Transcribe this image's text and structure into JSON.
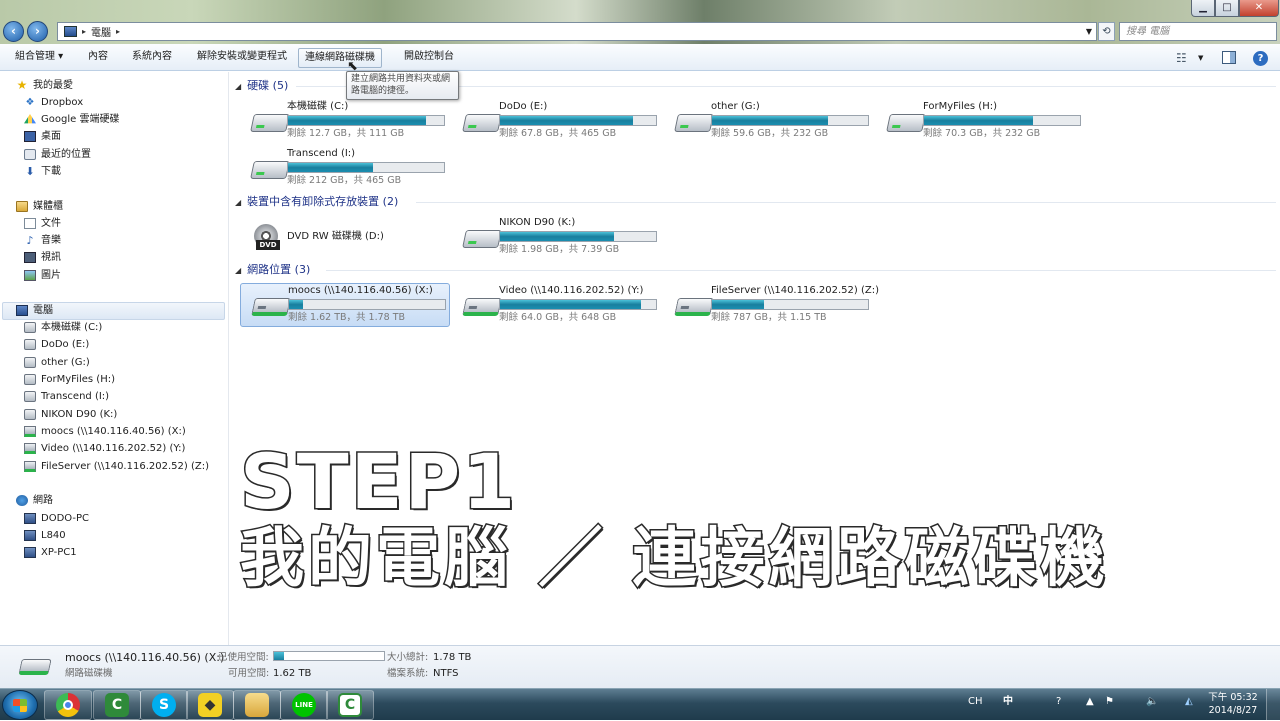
{
  "address": {
    "location": "電腦",
    "search_placeholder": "搜尋 電腦"
  },
  "window_buttons": {
    "minimize": "▁",
    "maximize": "□",
    "close": "✕"
  },
  "toolbar": {
    "organize": "組合管理 ▾",
    "properties": "內容",
    "system_properties": "系統內容",
    "uninstall": "解除安裝或變更程式",
    "map_drive": "連線網路磁碟機",
    "control_panel": "開啟控制台",
    "help": "?"
  },
  "tooltip": "建立網路共用資料夾或網路電腦的捷徑。",
  "sidebar": {
    "favorites": {
      "label": "我的最愛",
      "items": [
        "Dropbox",
        "Google 雲端硬碟",
        "桌面",
        "最近的位置",
        "下載"
      ]
    },
    "libraries": {
      "label": "媒體櫃",
      "items": [
        "文件",
        "音樂",
        "視訊",
        "圖片"
      ]
    },
    "computer": {
      "label": "電腦",
      "items": [
        "本機磁碟 (C:)",
        "DoDo (E:)",
        "other (G:)",
        "ForMyFiles (H:)",
        "Transcend (I:)",
        "NIKON D90 (K:)",
        "moocs (\\\\140.116.40.56) (X:)",
        "Video (\\\\140.116.202.52) (Y:)",
        "FileServer (\\\\140.116.202.52) (Z:)"
      ]
    },
    "network": {
      "label": "網路",
      "items": [
        "DODO-PC",
        "L840",
        "XP-PC1"
      ]
    }
  },
  "groups": {
    "hdd": {
      "title": "硬碟",
      "count": "(5)"
    },
    "removable": {
      "title": "裝置中含有卸除式存放裝置",
      "count": "(2)"
    },
    "network": {
      "title": "網路位置",
      "count": "(3)"
    }
  },
  "drives": {
    "c": {
      "name": "本機磁碟 (C:)",
      "info": "剩餘 12.7 GB，共 111 GB",
      "used_fraction": 0.886
    },
    "e": {
      "name": "DoDo (E:)",
      "info": "剩餘 67.8 GB，共 465 GB",
      "used_fraction": 0.854
    },
    "g": {
      "name": "other (G:)",
      "info": "剩餘 59.6 GB，共 232 GB",
      "used_fraction": 0.743
    },
    "h": {
      "name": "ForMyFiles (H:)",
      "info": "剩餘 70.3 GB，共 232 GB",
      "used_fraction": 0.697
    },
    "i": {
      "name": "Transcend (I:)",
      "info": "剩餘 212 GB，共 465 GB",
      "used_fraction": 0.544
    },
    "d": {
      "name": "DVD RW 磁碟機 (D:)"
    },
    "k": {
      "name": "NIKON D90 (K:)",
      "info": "剩餘 1.98 GB，共 7.39 GB",
      "used_fraction": 0.732
    },
    "x": {
      "name": "moocs (\\\\140.116.40.56) (X:)",
      "info": "剩餘 1.62 TB，共 1.78 TB",
      "used_fraction": 0.09
    },
    "y": {
      "name": "Video (\\\\140.116.202.52) (Y:)",
      "info": "剩餘 64.0 GB，共 648 GB",
      "used_fraction": 0.901
    },
    "z": {
      "name": "FileServer (\\\\140.116.202.52) (Z:)",
      "info": "剩餘 787 GB，共 1.15 TB",
      "used_fraction": 0.332
    }
  },
  "details": {
    "name": "moocs (\\\\140.116.40.56) (X:)",
    "type": "網路磁碟機",
    "used_label": "已使用空間:",
    "free_label": "可用空間:",
    "free_value": "1.62 TB",
    "total_label": "大小總計:",
    "total_value": "1.78 TB",
    "fs_label": "檔案系統:",
    "fs_value": "NTFS",
    "used_fraction": 0.09
  },
  "overlay": {
    "line1": "STEP1",
    "line2": "我的電腦 ／ 連接網路磁碟機"
  },
  "taskbar": {
    "apps": [
      "chrome",
      "camtasia",
      "skype",
      "sticky-notes",
      "explorer",
      "line",
      "camtasia-recorder"
    ],
    "tray": {
      "lang": "CH",
      "ime": "中",
      "time": "下午 05:32",
      "date": "2014/8/27"
    }
  },
  "colors": {
    "drive_bar": "#1a8eb0",
    "group_title": "#1e3287",
    "selection": "#c7dcf5"
  }
}
